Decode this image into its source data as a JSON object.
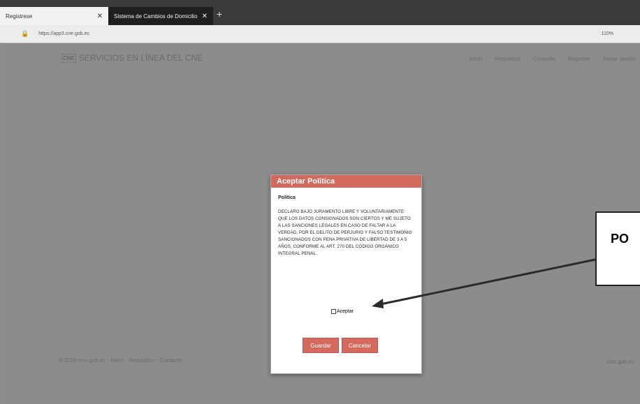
{
  "browser": {
    "tabs": [
      {
        "label": "Registrese"
      },
      {
        "label": "Sistema de Cambios de Domicilio"
      }
    ],
    "new_tab_symbol": "+",
    "close_symbol": "✕",
    "url": "https://app3.cne.gob.ec",
    "zoom": "110%"
  },
  "site": {
    "logo_mark": "CNE",
    "title": "SERVICIOS EN LÍNEA DEL CNE",
    "nav": [
      "Inicio",
      "Requisitos",
      "Consulta",
      "Registrar",
      "Iniciar sesión"
    ],
    "footer_left": "© 2020 cne.gob.ec · Inicio · Requisitos · Contacto",
    "footer_right": "cne.gob.ec"
  },
  "modal": {
    "header": "Aceptar Politica",
    "policy_title": "Política",
    "policy_text": "DECLARO BAJO JURAMENTO LIBRE Y VOLUNTARIAMENTE QUE LOS DATOS CONSIGNADOS SON CIERTOS Y ME SUJETO A LAS SANCIONES LEGALES EN CASO DE FALTAR A LA VERDAD, POR EL DELITO DE PERJURIO Y FALSO TESTIMONIO SANCIONADOS CON PENA PRIVATIVA DE LIBERTAD DE 3 A 5 AÑOS, CONFORME AL ART. 270 DEL CÓDIGO ORGÁNICO INTEGRAL PENAL.",
    "accept_label": "Aceptar",
    "save_label": "Guardar",
    "cancel_label": "Cancelar"
  },
  "annotation": {
    "callout_text": "PO"
  },
  "colors": {
    "modal_accent": "#d46a5e",
    "overlay": "#8c8c8c",
    "tab_dark": "#1f1f1f"
  }
}
